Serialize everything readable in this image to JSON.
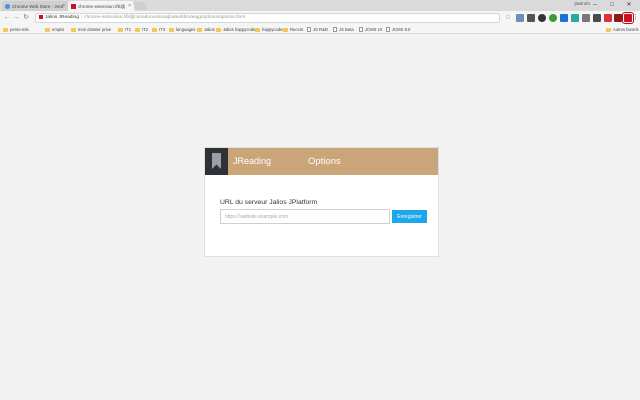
{
  "browser": {
    "tabs": [
      {
        "title": "Chrome Web Store - Jrea",
        "active": false
      },
      {
        "title": "chrome-extension://lkljfj",
        "active": true
      }
    ],
    "window_user": "jlaslrofo",
    "controls": {
      "minimize": "–",
      "maximize": "□",
      "close": "✕"
    },
    "address": {
      "site_label": "Jalios JReading",
      "url": "chrome-extension://lkljfjcooadoncekonpjbaleahbmaegg/options/options.html"
    },
    "bookmarks": [
      {
        "label": "perso-rele",
        "type": "folder"
      },
      {
        "label": "emploi",
        "type": "folder"
      },
      {
        "label": "mon dossier prive",
        "type": "folder"
      },
      {
        "label": "IT1",
        "type": "folder"
      },
      {
        "label": "IT2",
        "type": "folder"
      },
      {
        "label": "IT3",
        "type": "folder"
      },
      {
        "label": "languages",
        "type": "folder"
      },
      {
        "label": "Jalios",
        "type": "folder"
      },
      {
        "label": "Jalios happycoder",
        "type": "folder"
      },
      {
        "label": "happycoder",
        "type": "folder"
      },
      {
        "label": "Recent",
        "type": "folder"
      },
      {
        "label": "JS R&D",
        "type": "page"
      },
      {
        "label": "JS Beta",
        "type": "page"
      },
      {
        "label": "JCMS 10",
        "type": "page"
      },
      {
        "label": "JCMS 9.0",
        "type": "page"
      }
    ],
    "other_bookmarks": "Autres favoris"
  },
  "header": {
    "brand": "JReading",
    "title": "Options"
  },
  "form": {
    "label": "URL du serveur Jalios JPlatform",
    "placeholder": "https://website.example.com",
    "value": "",
    "save_label": "Enregistrer"
  },
  "colors": {
    "header_bg": "#cba57a",
    "logo_bg": "#2f3136",
    "button_bg": "#1ca8e8",
    "active_tab_favicon": "#c4161c"
  }
}
